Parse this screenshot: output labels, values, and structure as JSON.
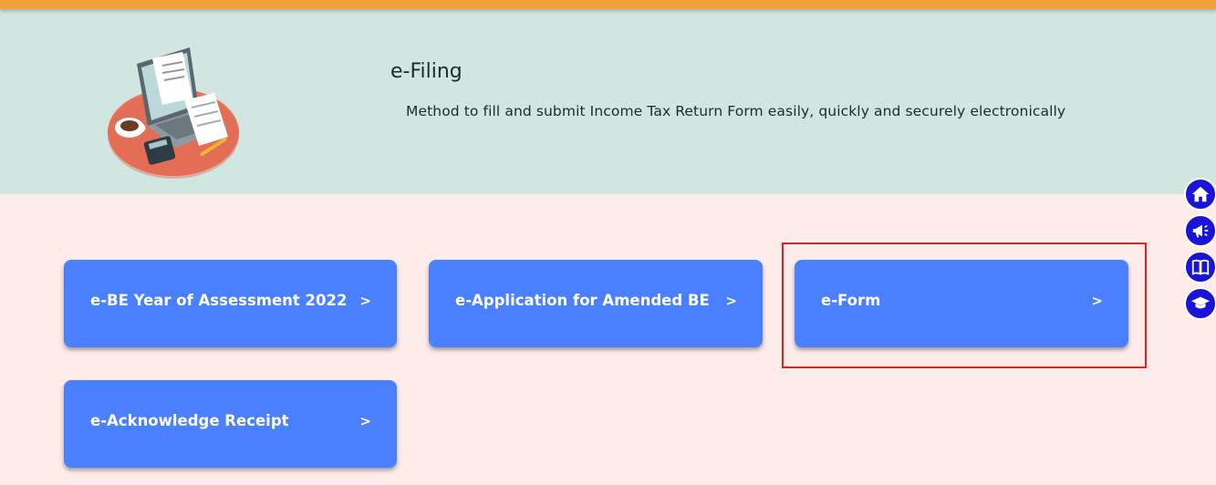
{
  "header": {
    "title": "e-Filing",
    "subtitle": "Method to fill and submit Income Tax Return Form easily, quickly and securely electronically",
    "illustration_icon": "tax-filing-illustration"
  },
  "cards": [
    {
      "label": "e-BE Year of Assessment 2022",
      "chevron": ">"
    },
    {
      "label": "e-Application for Amended BE",
      "chevron": ">"
    },
    {
      "label": "e-Form",
      "chevron": ">"
    },
    {
      "label": "e-Acknowledge Receipt",
      "chevron": ">"
    }
  ],
  "side_nav": [
    "home-icon",
    "megaphone-icon",
    "book-icon",
    "graduation-cap-icon"
  ],
  "colors": {
    "top_bar": "#f2a13a",
    "header_bg": "#d1e5e1",
    "page_bg": "#fdece9",
    "card_bg": "#4a80ff",
    "highlight": "#e32020",
    "side_nav_bg": "#1a14d8"
  }
}
